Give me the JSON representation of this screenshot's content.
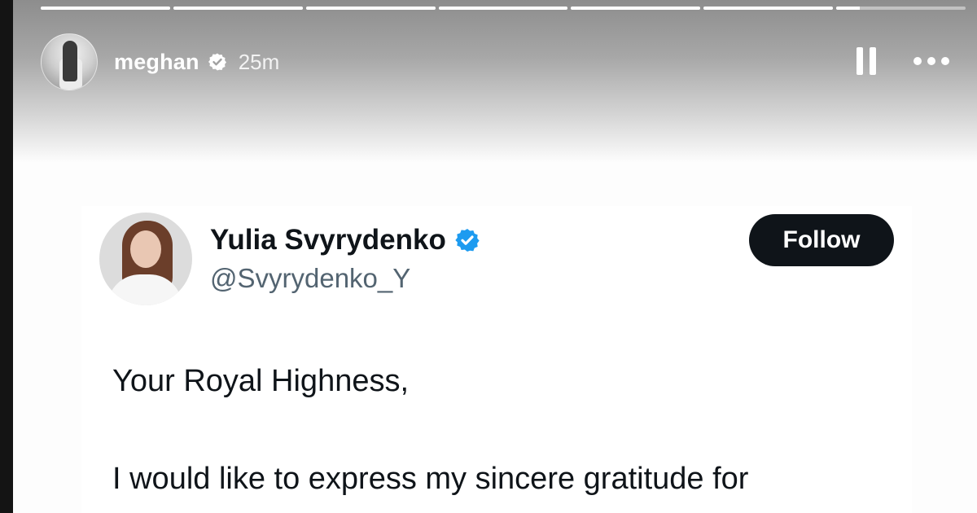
{
  "story": {
    "progress_segments": [
      1,
      1,
      1,
      1,
      1,
      1,
      0.18
    ],
    "username": "meghan",
    "verified_icon": "verified-badge-icon",
    "time": "25m",
    "pause_icon": "pause-icon",
    "more_icon": "more-horizontal-icon"
  },
  "tweet": {
    "name": "Yulia Svyrydenko",
    "verified_icon": "blue-verified-badge-icon",
    "verified_color": "#1d9bf0",
    "handle": "@Svyrydenko_Y",
    "follow_label": "Follow",
    "body": {
      "line1": "Your Royal Highness,",
      "line2": "I would like to express my sincere gratitude for"
    }
  }
}
